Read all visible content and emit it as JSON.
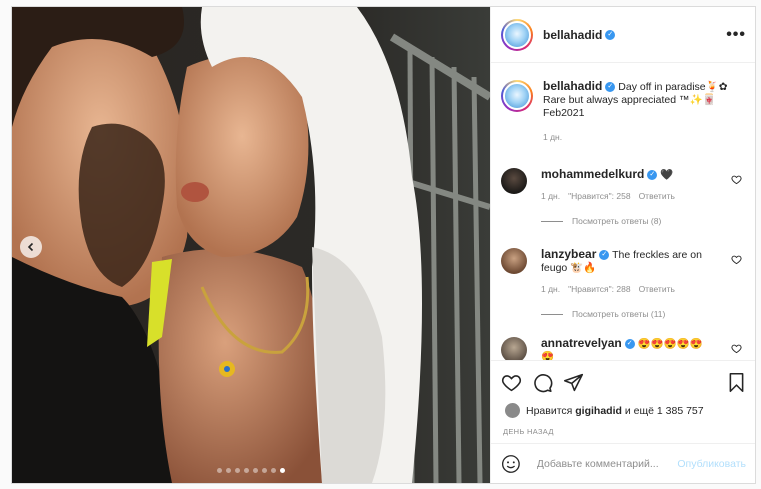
{
  "post": {
    "image_alt": "photo",
    "carousel": {
      "count": 8,
      "active": 8
    }
  },
  "header": {
    "username": "bellahadid",
    "verified_icon": "verified-badge-icon",
    "more_icon": "more-options-icon",
    "more_glyph": "•••"
  },
  "caption": {
    "username": "bellahadid",
    "text": "Day off in paradise🍹✿ Rare but always appreciated ™✨🀄 Feb2021",
    "time": "1 дн."
  },
  "comments": [
    {
      "username": "mohammedelkurd",
      "text": "🖤",
      "time": "1 дн.",
      "likes": "\"Нравится\": 258",
      "reply": "Ответить",
      "view_replies": "Посмотреть ответы (8)"
    },
    {
      "username": "lanzybear",
      "text": "The freckles are on feugo 🐮🔥",
      "time": "1 дн.",
      "likes": "\"Нравится\": 288",
      "reply": "Ответить",
      "view_replies": "Посмотреть ответы (11)"
    },
    {
      "username": "annatrevelyan",
      "text": "😍😍😍😍😍😍"
    }
  ],
  "actions": {
    "likes_prefix": "Нравится",
    "likes_user": "gigihadid",
    "likes_suffix": "и ещё 1 385 757",
    "timestamp": "ДЕНЬ НАЗАД"
  },
  "add_comment": {
    "placeholder": "Добавьте комментарий...",
    "publish": "Опубликовать"
  },
  "colors": {
    "accent": "#3897f0",
    "publish_disabled": "#b2dffc",
    "border": "#dbdbdb"
  }
}
